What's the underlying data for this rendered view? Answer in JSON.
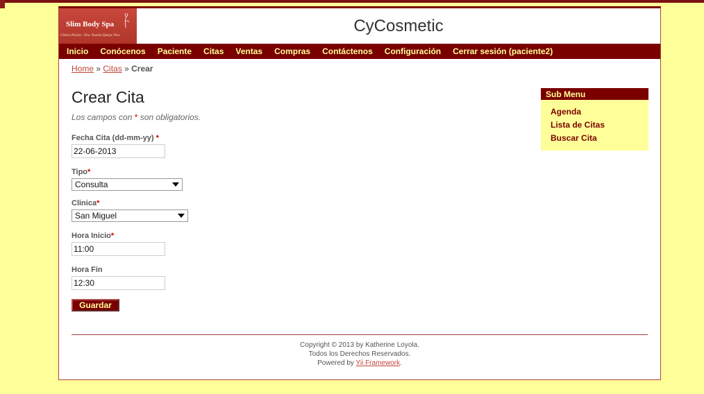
{
  "logo": {
    "name": "Slim Body Spa",
    "subtitle": "Clínica Pasión - Dra. Yesenia Quispe Vera"
  },
  "site_title": "CyCosmetic",
  "nav": [
    "Inicio",
    "Conócenos",
    "Paciente",
    "Citas",
    "Ventas",
    "Compras",
    "Contáctenos",
    "Configuración",
    "Cerrar sesión (paciente2)"
  ],
  "breadcrumb": {
    "home": "Home",
    "sep1": "»",
    "citas": "Citas",
    "sep2": "»",
    "current": "Crear"
  },
  "form": {
    "title": "Crear Cita",
    "note_prefix": "Los campos con",
    "note_req": "*",
    "note_suffix": "son obligatorios.",
    "fecha_label": "Fecha Cita (dd-mm-yy)",
    "fecha_value": "22-06-2013",
    "tipo_label": "Tipo",
    "tipo_value": "Consulta",
    "clinica_label": "Clinica",
    "clinica_value": "San Miguel",
    "hora_inicio_label": "Hora Inicio",
    "hora_inicio_value": "11:00",
    "hora_fin_label": "Hora Fin",
    "hora_fin_value": "12:30",
    "required_mark": "*",
    "submit_label": "Guardar"
  },
  "sidebar": {
    "title": "Sub Menu",
    "items": [
      "Agenda",
      "Lista de Citas",
      "Buscar Cita"
    ]
  },
  "footer": {
    "line1": "Copyright © 2013 by Katherine Loyola.",
    "line2": "Todos los Derechos Reservados.",
    "powered_prefix": "Powered by",
    "powered_link": "Yii Framework",
    "powered_suffix": "."
  },
  "colors": {
    "background": "#ffff99",
    "menu": "#7a0000",
    "link": "#c0453a"
  }
}
